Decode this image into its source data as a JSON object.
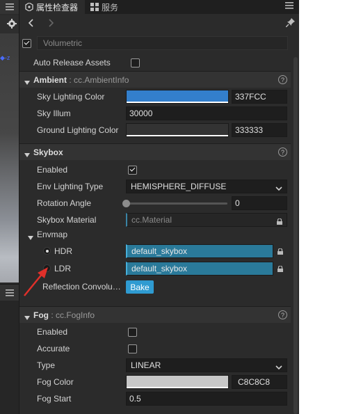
{
  "tabs": [
    {
      "label": "属性检查器",
      "icon": "inspector-icon",
      "active": true
    },
    {
      "label": "服务",
      "icon": "services-grid-icon",
      "active": false
    }
  ],
  "volumetric": {
    "label": "Volumetric",
    "checked": true
  },
  "auto_release": {
    "label": "Auto Release Assets",
    "checked": false
  },
  "ambient": {
    "title": "Ambient",
    "type": ": cc.AmbientInfo",
    "sky_lighting_color": {
      "label": "Sky Lighting Color",
      "hex": "337FCC",
      "color": "#337FCC"
    },
    "sky_illum": {
      "label": "Sky Illum",
      "value": "30000"
    },
    "ground_lighting_color": {
      "label": "Ground Lighting Color",
      "hex": "333333",
      "color": "#333333"
    }
  },
  "skybox": {
    "title": "Skybox",
    "enabled": {
      "label": "Enabled",
      "checked": true
    },
    "env_lighting_type": {
      "label": "Env Lighting Type",
      "value": "HEMISPHERE_DIFFUSE"
    },
    "rotation_angle": {
      "label": "Rotation Angle",
      "value": "0",
      "fraction": 0
    },
    "skybox_material": {
      "label": "Skybox Material",
      "value": "cc.Material"
    },
    "envmap": {
      "label": "Envmap",
      "hdr": {
        "label": "HDR",
        "value": "default_skybox",
        "selected": true
      },
      "ldr": {
        "label": "LDR",
        "value": "default_skybox",
        "selected": false
      }
    },
    "reflection": {
      "label": "Reflection Convolu…",
      "button": "Bake"
    }
  },
  "fog": {
    "title": "Fog",
    "type": ": cc.FogInfo",
    "enabled": {
      "label": "Enabled",
      "checked": false
    },
    "accurate": {
      "label": "Accurate",
      "checked": false
    },
    "fog_type": {
      "label": "Type",
      "value": "LINEAR"
    },
    "fog_color": {
      "label": "Fog Color",
      "hex": "C8C8C8",
      "color": "#C8C8C8"
    },
    "fog_start": {
      "label": "Fog Start",
      "value": "0.5"
    }
  },
  "accent_color": "#2F9BD1",
  "annotation_arrow_color": "#E0302A"
}
